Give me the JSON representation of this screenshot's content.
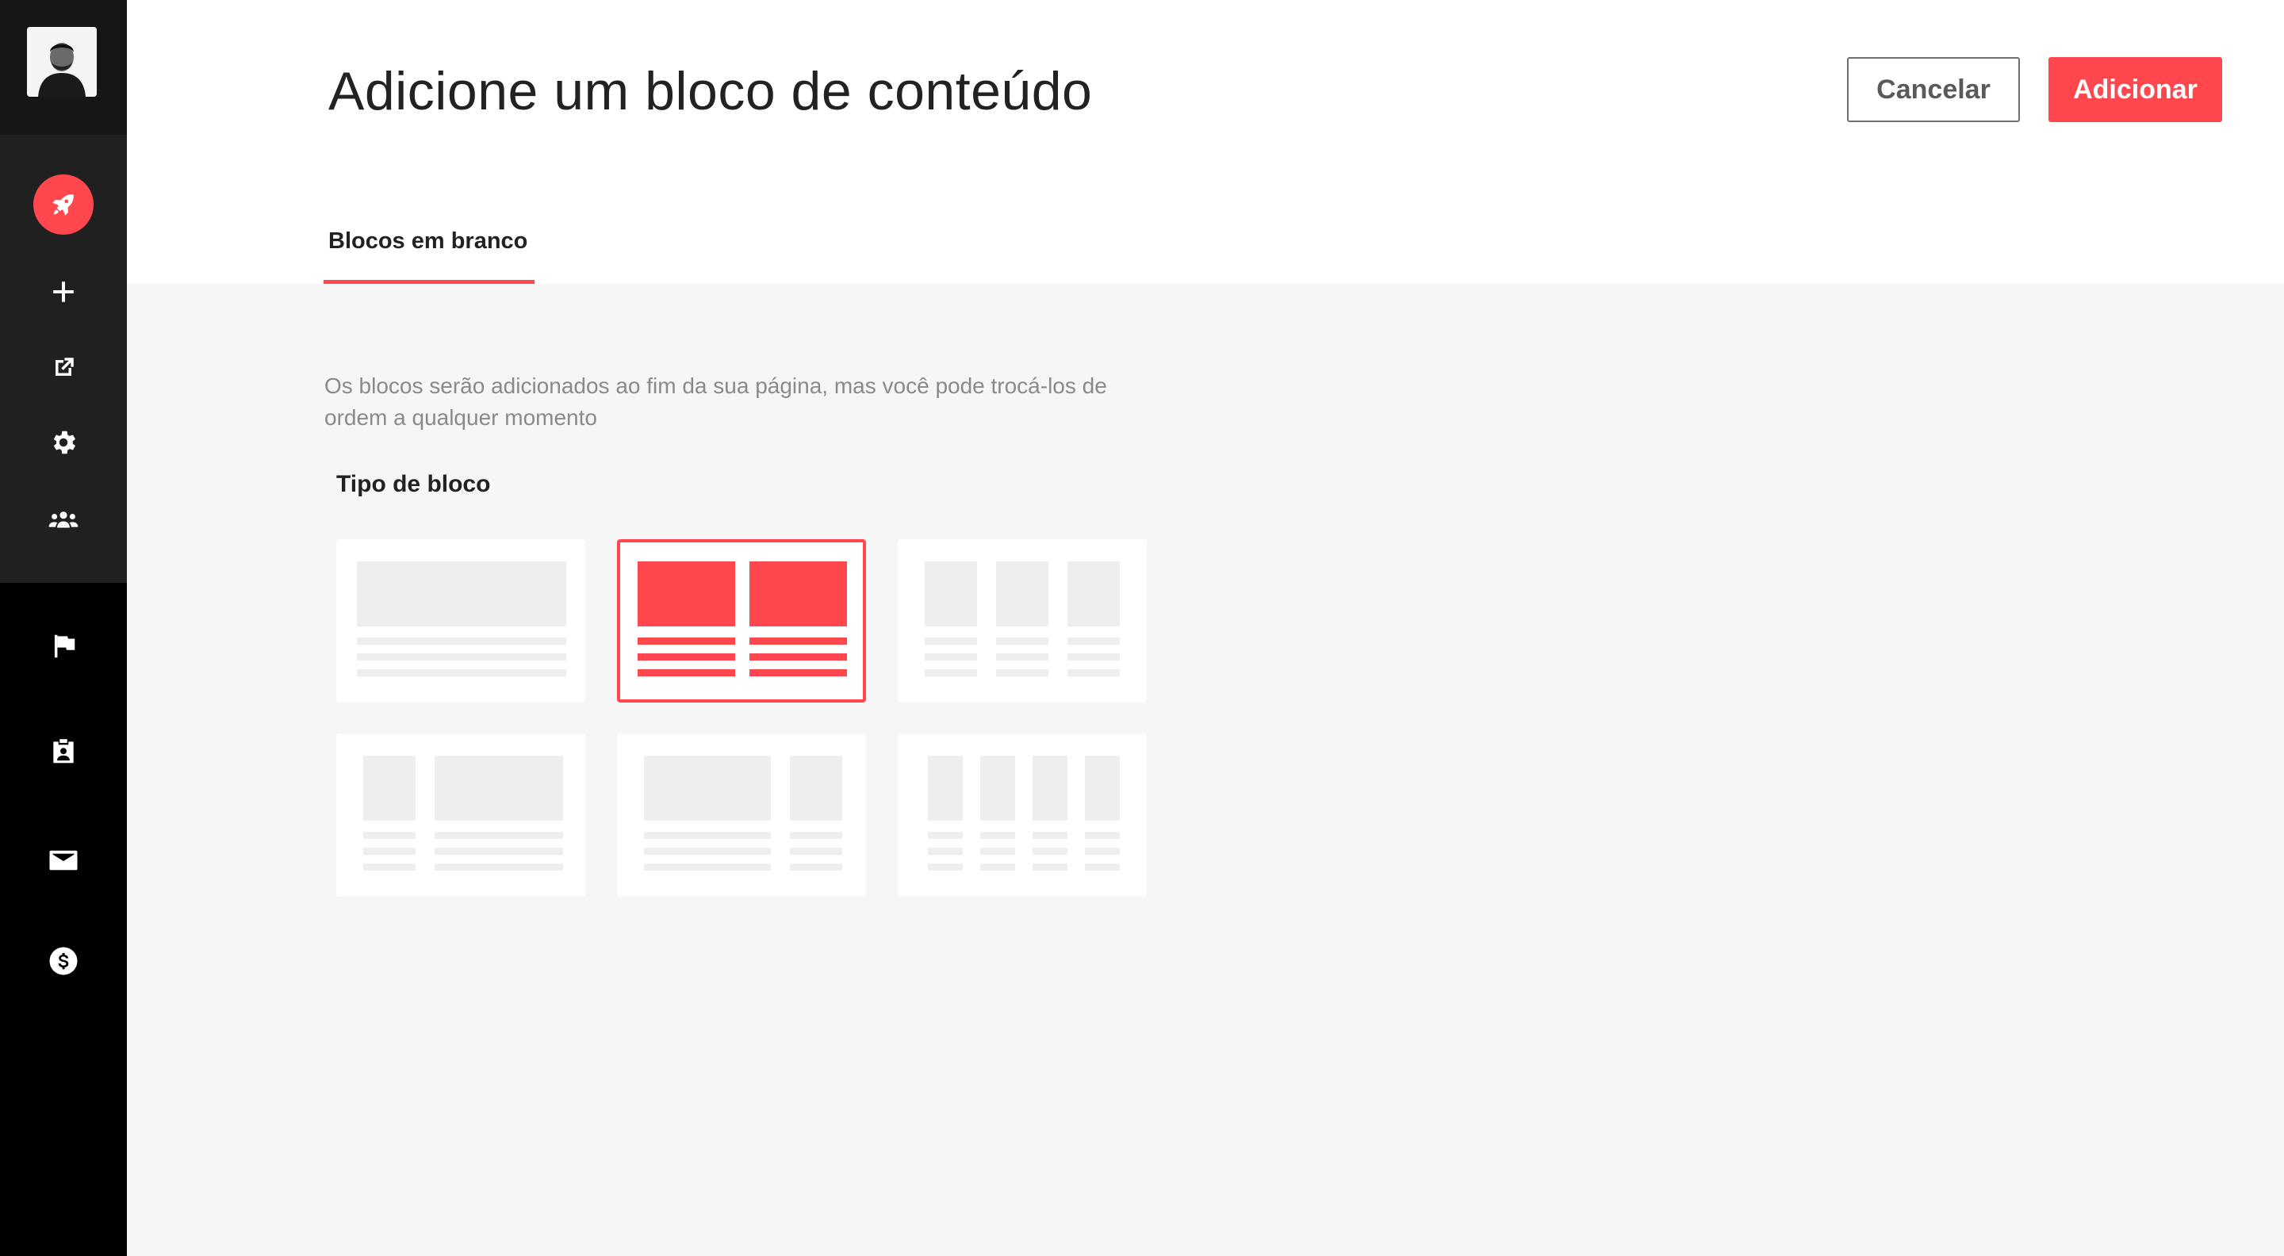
{
  "sidebar": {
    "avatar_icon": "user-avatar",
    "accent_color": "#ff474d",
    "items": [
      {
        "icon": "rocket-icon",
        "active": true
      },
      {
        "icon": "plus-icon"
      },
      {
        "icon": "external-link-icon"
      },
      {
        "icon": "gear-icon"
      },
      {
        "icon": "group-icon"
      },
      {
        "icon": "flag-icon"
      },
      {
        "icon": "id-badge-icon"
      },
      {
        "icon": "mail-icon"
      },
      {
        "icon": "dollar-icon"
      }
    ]
  },
  "header": {
    "title": "Adicione um bloco de conteúdo",
    "cancel_label": "Cancelar",
    "add_label": "Adicionar"
  },
  "tabs": [
    {
      "label": "Blocos em branco",
      "active": true
    }
  ],
  "content": {
    "description": "Os blocos serão adicionados ao fim da sua página, mas você pode trocá-los de ordem a qualquer momento",
    "section_label": "Tipo de bloco",
    "selected_layout": "two-columns",
    "layouts": [
      "single-column",
      "two-columns",
      "three-columns",
      "narrow-wide",
      "wide-narrow",
      "four-columns"
    ]
  },
  "colors": {
    "accent": "#ff474d",
    "placeholder": "#eeeeee",
    "sidebar": "#000000"
  }
}
